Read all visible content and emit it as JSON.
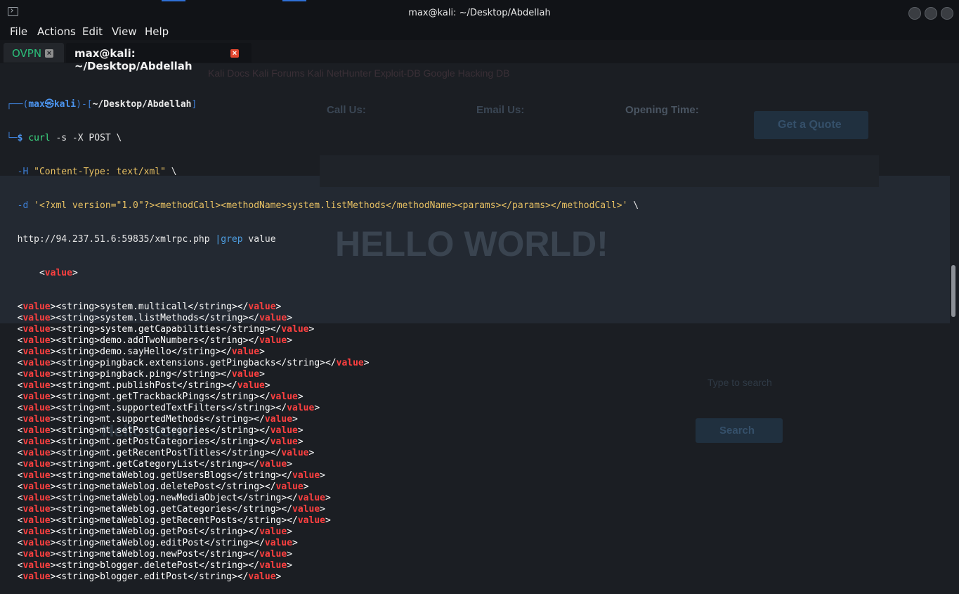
{
  "window": {
    "title": "max@kali: ~/Desktop/Abdellah"
  },
  "menu": {
    "file": "File",
    "actions": "Actions",
    "edit": "Edit",
    "view": "View",
    "help": "Help"
  },
  "tabs": [
    {
      "label": "OVPN",
      "active": false
    },
    {
      "label": "max@kali: ~/Desktop/Abdellah",
      "active": true
    }
  ],
  "background_page": {
    "heading": "HELLO WORLD!",
    "subheading": "Hello world!",
    "call_us": "Call Us:",
    "email_us": "Email Us:",
    "opening_time": "Opening Time:",
    "quote_button": "Get a Quote",
    "search_placeholder": "Type to search",
    "search_button": "Search",
    "bookmarks": "Kali Docs   Kali Forums   Kali NetHunter   Exploit-DB   Google Hacking DB"
  },
  "prompt": {
    "user": "max",
    "symbol": "㉿",
    "host": "kali",
    "path": "~/Desktop/Abdellah",
    "dollar": "$"
  },
  "command": {
    "curl": "curl",
    "flags": " -s -X POST \\",
    "h_flag": "-H ",
    "header": "\"Content-Type: text/xml\"",
    "d_flag": "-d ",
    "body_open": "'<?xml version=\"1.0\"?><methodCall><methodName>system.listMethods</methodName><params></params></methodCall>'",
    "url": "http://94.237.51.6:59835/xmlrpc.php",
    "pipe": "|",
    "grep": "grep",
    "grep_arg": " value"
  },
  "output": {
    "first_indent": "    ",
    "tag_word": "value",
    "methods": [
      "system.multicall",
      "system.listMethods",
      "system.getCapabilities",
      "demo.addTwoNumbers",
      "demo.sayHello",
      "pingback.extensions.getPingbacks",
      "pingback.ping",
      "mt.publishPost",
      "mt.getTrackbackPings",
      "mt.supportedTextFilters",
      "mt.supportedMethods",
      "mt.setPostCategories",
      "mt.getPostCategories",
      "mt.getRecentPostTitles",
      "mt.getCategoryList",
      "metaWeblog.getUsersBlogs",
      "metaWeblog.deletePost",
      "metaWeblog.newMediaObject",
      "metaWeblog.getCategories",
      "metaWeblog.getRecentPosts",
      "metaWeblog.getPost",
      "metaWeblog.editPost",
      "metaWeblog.newPost",
      "blogger.deletePost",
      "blogger.editPost"
    ]
  },
  "colors": {
    "terminal_bg": "#1b1e23",
    "prompt_user": "#4c95f0",
    "grep_match": "#ff4040",
    "string_yellow": "#e8c163",
    "ovpn_tab": "#2bbf7a",
    "close_active": "#e2472f"
  }
}
